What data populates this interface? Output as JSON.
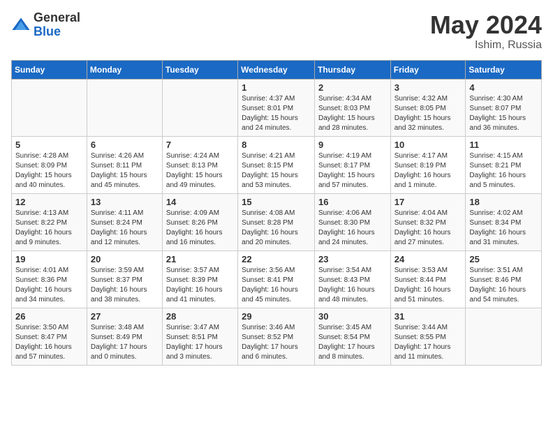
{
  "logo": {
    "general": "General",
    "blue": "Blue"
  },
  "title": {
    "month": "May 2024",
    "location": "Ishim, Russia"
  },
  "weekdays": [
    "Sunday",
    "Monday",
    "Tuesday",
    "Wednesday",
    "Thursday",
    "Friday",
    "Saturday"
  ],
  "weeks": [
    [
      {
        "num": "",
        "info": ""
      },
      {
        "num": "",
        "info": ""
      },
      {
        "num": "",
        "info": ""
      },
      {
        "num": "1",
        "info": "Sunrise: 4:37 AM\nSunset: 8:01 PM\nDaylight: 15 hours\nand 24 minutes."
      },
      {
        "num": "2",
        "info": "Sunrise: 4:34 AM\nSunset: 8:03 PM\nDaylight: 15 hours\nand 28 minutes."
      },
      {
        "num": "3",
        "info": "Sunrise: 4:32 AM\nSunset: 8:05 PM\nDaylight: 15 hours\nand 32 minutes."
      },
      {
        "num": "4",
        "info": "Sunrise: 4:30 AM\nSunset: 8:07 PM\nDaylight: 15 hours\nand 36 minutes."
      }
    ],
    [
      {
        "num": "5",
        "info": "Sunrise: 4:28 AM\nSunset: 8:09 PM\nDaylight: 15 hours\nand 40 minutes."
      },
      {
        "num": "6",
        "info": "Sunrise: 4:26 AM\nSunset: 8:11 PM\nDaylight: 15 hours\nand 45 minutes."
      },
      {
        "num": "7",
        "info": "Sunrise: 4:24 AM\nSunset: 8:13 PM\nDaylight: 15 hours\nand 49 minutes."
      },
      {
        "num": "8",
        "info": "Sunrise: 4:21 AM\nSunset: 8:15 PM\nDaylight: 15 hours\nand 53 minutes."
      },
      {
        "num": "9",
        "info": "Sunrise: 4:19 AM\nSunset: 8:17 PM\nDaylight: 15 hours\nand 57 minutes."
      },
      {
        "num": "10",
        "info": "Sunrise: 4:17 AM\nSunset: 8:19 PM\nDaylight: 16 hours\nand 1 minute."
      },
      {
        "num": "11",
        "info": "Sunrise: 4:15 AM\nSunset: 8:21 PM\nDaylight: 16 hours\nand 5 minutes."
      }
    ],
    [
      {
        "num": "12",
        "info": "Sunrise: 4:13 AM\nSunset: 8:22 PM\nDaylight: 16 hours\nand 9 minutes."
      },
      {
        "num": "13",
        "info": "Sunrise: 4:11 AM\nSunset: 8:24 PM\nDaylight: 16 hours\nand 12 minutes."
      },
      {
        "num": "14",
        "info": "Sunrise: 4:09 AM\nSunset: 8:26 PM\nDaylight: 16 hours\nand 16 minutes."
      },
      {
        "num": "15",
        "info": "Sunrise: 4:08 AM\nSunset: 8:28 PM\nDaylight: 16 hours\nand 20 minutes."
      },
      {
        "num": "16",
        "info": "Sunrise: 4:06 AM\nSunset: 8:30 PM\nDaylight: 16 hours\nand 24 minutes."
      },
      {
        "num": "17",
        "info": "Sunrise: 4:04 AM\nSunset: 8:32 PM\nDaylight: 16 hours\nand 27 minutes."
      },
      {
        "num": "18",
        "info": "Sunrise: 4:02 AM\nSunset: 8:34 PM\nDaylight: 16 hours\nand 31 minutes."
      }
    ],
    [
      {
        "num": "19",
        "info": "Sunrise: 4:01 AM\nSunset: 8:36 PM\nDaylight: 16 hours\nand 34 minutes."
      },
      {
        "num": "20",
        "info": "Sunrise: 3:59 AM\nSunset: 8:37 PM\nDaylight: 16 hours\nand 38 minutes."
      },
      {
        "num": "21",
        "info": "Sunrise: 3:57 AM\nSunset: 8:39 PM\nDaylight: 16 hours\nand 41 minutes."
      },
      {
        "num": "22",
        "info": "Sunrise: 3:56 AM\nSunset: 8:41 PM\nDaylight: 16 hours\nand 45 minutes."
      },
      {
        "num": "23",
        "info": "Sunrise: 3:54 AM\nSunset: 8:43 PM\nDaylight: 16 hours\nand 48 minutes."
      },
      {
        "num": "24",
        "info": "Sunrise: 3:53 AM\nSunset: 8:44 PM\nDaylight: 16 hours\nand 51 minutes."
      },
      {
        "num": "25",
        "info": "Sunrise: 3:51 AM\nSunset: 8:46 PM\nDaylight: 16 hours\nand 54 minutes."
      }
    ],
    [
      {
        "num": "26",
        "info": "Sunrise: 3:50 AM\nSunset: 8:47 PM\nDaylight: 16 hours\nand 57 minutes."
      },
      {
        "num": "27",
        "info": "Sunrise: 3:48 AM\nSunset: 8:49 PM\nDaylight: 17 hours\nand 0 minutes."
      },
      {
        "num": "28",
        "info": "Sunrise: 3:47 AM\nSunset: 8:51 PM\nDaylight: 17 hours\nand 3 minutes."
      },
      {
        "num": "29",
        "info": "Sunrise: 3:46 AM\nSunset: 8:52 PM\nDaylight: 17 hours\nand 6 minutes."
      },
      {
        "num": "30",
        "info": "Sunrise: 3:45 AM\nSunset: 8:54 PM\nDaylight: 17 hours\nand 8 minutes."
      },
      {
        "num": "31",
        "info": "Sunrise: 3:44 AM\nSunset: 8:55 PM\nDaylight: 17 hours\nand 11 minutes."
      },
      {
        "num": "",
        "info": ""
      }
    ]
  ]
}
